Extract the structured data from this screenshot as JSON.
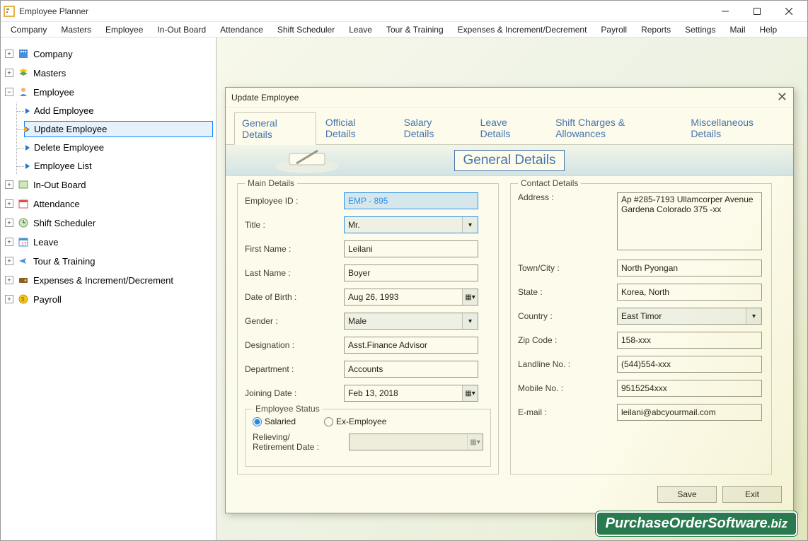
{
  "app": {
    "title": "Employee Planner"
  },
  "menu": [
    "Company",
    "Masters",
    "Employee",
    "In-Out Board",
    "Attendance",
    "Shift Scheduler",
    "Leave",
    "Tour & Training",
    "Expenses & Increment/Decrement",
    "Payroll",
    "Reports",
    "Settings",
    "Mail",
    "Help"
  ],
  "tree": {
    "company": "Company",
    "masters": "Masters",
    "employee": "Employee",
    "add": "Add Employee",
    "update": "Update Employee",
    "delete": "Delete Employee",
    "list": "Employee List",
    "inout": "In-Out Board",
    "attendance": "Attendance",
    "shift": "Shift Scheduler",
    "leave": "Leave",
    "tour": "Tour & Training",
    "expenses": "Expenses & Increment/Decrement",
    "payroll": "Payroll"
  },
  "dialog": {
    "title": "Update Employee",
    "tabs": [
      "General Details",
      "Official Details",
      "Salary Details",
      "Leave Details",
      "Shift Charges & Allowances",
      "Miscellaneous Details"
    ],
    "banner_title": "General Details",
    "main_legend": "Main Details",
    "contact_legend": "Contact Details",
    "status_legend": "Employee Status",
    "labels": {
      "employee_id": "Employee ID :",
      "title": "Title :",
      "first_name": "First Name :",
      "last_name": "Last Name :",
      "dob": "Date of Birth :",
      "gender": "Gender :",
      "designation": "Designation :",
      "department": "Department :",
      "joining": "Joining Date :",
      "salaried": "Salaried",
      "exemp": "Ex-Employee",
      "relieving": "Relieving/\nRetirement Date :",
      "address": "Address :",
      "town": "Town/City :",
      "state": "State :",
      "country": "Country :",
      "zip": "Zip Code :",
      "landline": "Landline No. :",
      "mobile": "Mobile No. :",
      "email": "E-mail :"
    },
    "values": {
      "employee_id": "EMP - 895",
      "title": "Mr.",
      "first_name": "Leilani",
      "last_name": "Boyer",
      "dob": "Aug 26, 1993",
      "gender": "Male",
      "designation": "Asst.Finance Advisor",
      "department": "Accounts",
      "joining": "Feb 13, 2018",
      "relieving": "",
      "address": "Ap #285-7193 Ullamcorper Avenue Gardena Colorado 375 -xx",
      "town": "North Pyongan",
      "state": "Korea, North",
      "country": "East Timor",
      "zip": "158-xxx",
      "landline": "(544)554-xxx",
      "mobile": "9515254xxx",
      "email": "leilani@abcyourmail.com"
    },
    "buttons": {
      "save": "Save",
      "exit": "Exit"
    }
  },
  "footer": {
    "logo_main": "PurchaseOrderSoftware",
    "logo_suffix": ".biz"
  }
}
